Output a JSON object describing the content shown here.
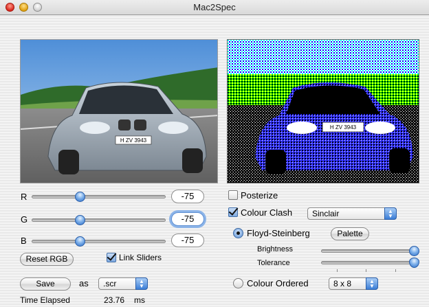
{
  "window": {
    "title": "Mac2Spec"
  },
  "rgb": {
    "r_label": "R",
    "r_value": "-75",
    "g_label": "G",
    "g_value": "-75",
    "b_label": "B",
    "b_value": "-75",
    "reset_label": "Reset RGB",
    "link_label": "Link Sliders",
    "link_checked": true
  },
  "save": {
    "save_label": "Save",
    "as_label": "as",
    "format_value": ".scr"
  },
  "timing": {
    "label": "Time Elapsed",
    "value": "23.76",
    "unit": "ms"
  },
  "options": {
    "posterize_label": "Posterize",
    "posterize_checked": false,
    "colour_clash_label": "Colour Clash",
    "colour_clash_checked": true,
    "clash_mode": "Sinclair",
    "floyd_label": "Floyd-Steinberg",
    "floyd_selected": true,
    "palette_label": "Palette",
    "brightness_label": "Brightness",
    "tolerance_label": "Tolerance",
    "ordered_label": "Colour Ordered",
    "ordered_selected": false,
    "ordered_size": "8 x 8"
  },
  "images": {
    "source_plate": "H ZV 3943",
    "output_plate": "H ZV 3943"
  },
  "icons": {
    "popup_arrows": "updown-arrows-icon",
    "close": "close-button-icon",
    "minimize": "minimize-button-icon",
    "zoom": "zoom-button-icon"
  }
}
